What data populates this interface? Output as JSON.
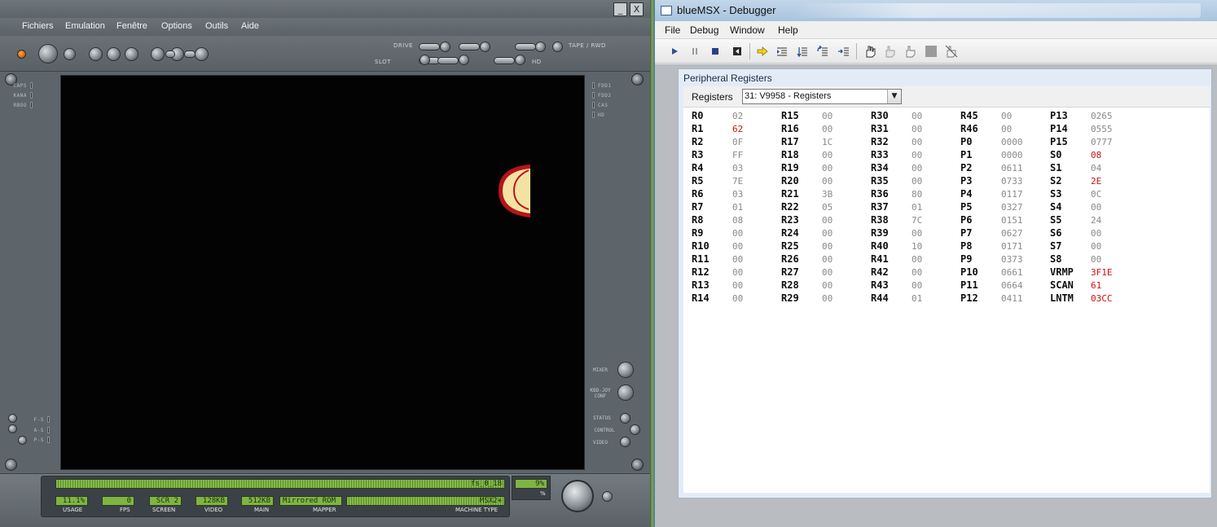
{
  "emulator": {
    "menu": [
      "Fichiers",
      "Emulation",
      "Fenêtre",
      "Options",
      "Outils",
      "Aide"
    ],
    "window_buttons": {
      "minimize": "_",
      "close": "X"
    },
    "toolbar_labels": {
      "drive": "DRIVE",
      "slot": "SLOT",
      "tape": "TAPE / RWD",
      "hd": "HD"
    },
    "left_leds": [
      "CAPS",
      "KANA",
      "RBOO"
    ],
    "right_leds": [
      "FDD1",
      "FDD2",
      "CAS",
      "HD"
    ],
    "lower_left_leds": [
      "F-S",
      "A-S",
      "P-S"
    ],
    "side_buttons": {
      "mixer": "MIXER",
      "kbd_joy": "KBD-JOY CONF",
      "status": "STATUS",
      "control": "CONTROL",
      "video": "VIDEO"
    },
    "status": {
      "rom_name": "fs_0_18",
      "usage": "11.1%",
      "fps": "0",
      "screen": "SCR 2",
      "video": "128KB",
      "main": "512KB",
      "mapper": "Mirrored ROM",
      "machine_type": "MSX2+",
      "cpu": "9%",
      "cpu_caption": "%",
      "captions": {
        "usage": "USAGE",
        "fps": "FPS",
        "screen": "SCREEN",
        "video": "VIDEO",
        "main": "MAIN",
        "mapper": "MAPPER",
        "machine_type": "MACHINE TYPE"
      }
    }
  },
  "debugger": {
    "title": "blueMSX - Debugger",
    "menu": [
      "File",
      "Debug",
      "Window",
      "Help"
    ],
    "panel_title": "Peripheral Registers",
    "registers_label": "Registers",
    "selected_device": "31: V9958 - Registers",
    "columns": [
      [
        [
          "R0",
          "02",
          false
        ],
        [
          "R1",
          "62",
          true
        ],
        [
          "R2",
          "0F",
          false
        ],
        [
          "R3",
          "FF",
          false
        ],
        [
          "R4",
          "03",
          false
        ],
        [
          "R5",
          "7E",
          false
        ],
        [
          "R6",
          "03",
          false
        ],
        [
          "R7",
          "01",
          false
        ],
        [
          "R8",
          "08",
          false
        ],
        [
          "R9",
          "00",
          false
        ],
        [
          "R10",
          "00",
          false
        ],
        [
          "R11",
          "00",
          false
        ],
        [
          "R12",
          "00",
          false
        ],
        [
          "R13",
          "00",
          false
        ],
        [
          "R14",
          "00",
          false
        ]
      ],
      [
        [
          "R15",
          "00",
          false
        ],
        [
          "R16",
          "00",
          false
        ],
        [
          "R17",
          "1C",
          false
        ],
        [
          "R18",
          "00",
          false
        ],
        [
          "R19",
          "00",
          false
        ],
        [
          "R20",
          "00",
          false
        ],
        [
          "R21",
          "3B",
          false
        ],
        [
          "R22",
          "05",
          false
        ],
        [
          "R23",
          "00",
          false
        ],
        [
          "R24",
          "00",
          false
        ],
        [
          "R25",
          "00",
          false
        ],
        [
          "R26",
          "00",
          false
        ],
        [
          "R27",
          "00",
          false
        ],
        [
          "R28",
          "00",
          false
        ],
        [
          "R29",
          "00",
          false
        ]
      ],
      [
        [
          "R30",
          "00",
          false
        ],
        [
          "R31",
          "00",
          false
        ],
        [
          "R32",
          "00",
          false
        ],
        [
          "R33",
          "00",
          false
        ],
        [
          "R34",
          "00",
          false
        ],
        [
          "R35",
          "00",
          false
        ],
        [
          "R36",
          "80",
          false
        ],
        [
          "R37",
          "01",
          false
        ],
        [
          "R38",
          "7C",
          false
        ],
        [
          "R39",
          "00",
          false
        ],
        [
          "R40",
          "10",
          false
        ],
        [
          "R41",
          "00",
          false
        ],
        [
          "R42",
          "00",
          false
        ],
        [
          "R43",
          "00",
          false
        ],
        [
          "R44",
          "01",
          false
        ]
      ],
      [
        [
          "R45",
          "00",
          false
        ],
        [
          "R46",
          "00",
          false
        ],
        [
          "P0",
          "0000",
          false
        ],
        [
          "P1",
          "0000",
          false
        ],
        [
          "P2",
          "0611",
          false
        ],
        [
          "P3",
          "0733",
          false
        ],
        [
          "P4",
          "0117",
          false
        ],
        [
          "P5",
          "0327",
          false
        ],
        [
          "P6",
          "0151",
          false
        ],
        [
          "P7",
          "0627",
          false
        ],
        [
          "P8",
          "0171",
          false
        ],
        [
          "P9",
          "0373",
          false
        ],
        [
          "P10",
          "0661",
          false
        ],
        [
          "P11",
          "0664",
          false
        ],
        [
          "P12",
          "0411",
          false
        ]
      ],
      [
        [
          "P13",
          "0265",
          false
        ],
        [
          "P14",
          "0555",
          false
        ],
        [
          "P15",
          "0777",
          false
        ],
        [
          "S0",
          "08",
          true
        ],
        [
          "S1",
          "04",
          false
        ],
        [
          "S2",
          "2E",
          true
        ],
        [
          "S3",
          "0C",
          false
        ],
        [
          "S4",
          "00",
          false
        ],
        [
          "S5",
          "24",
          false
        ],
        [
          "S6",
          "00",
          false
        ],
        [
          "S7",
          "00",
          false
        ],
        [
          "S8",
          "00",
          false
        ],
        [
          "VRMP",
          "3F1E",
          true
        ],
        [
          "SCAN",
          "61",
          true
        ],
        [
          "LNTM",
          "03CC",
          true
        ]
      ]
    ]
  }
}
